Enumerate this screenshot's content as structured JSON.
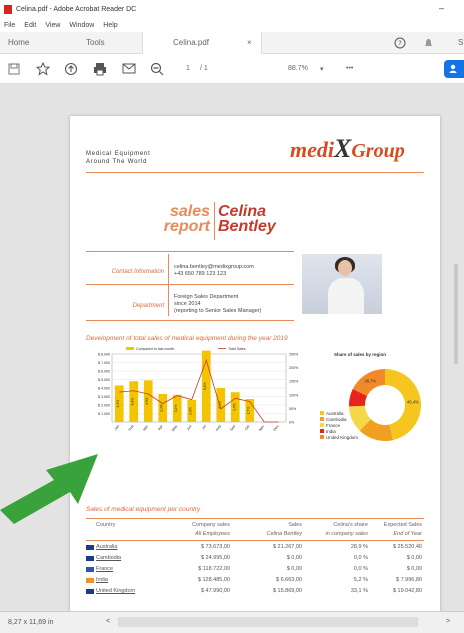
{
  "titlebar": {
    "title": "Celina.pdf - Adobe Acrobat Reader DC",
    "minimize": "–"
  },
  "menu": [
    "File",
    "Edit",
    "View",
    "Window",
    "Help"
  ],
  "tabs": {
    "home": "Home",
    "tools": "Tools",
    "doc": "Celina.pdf",
    "close": "×"
  },
  "toolbar": {
    "page_current": "1",
    "page_total": "/ 1",
    "zoom": "88.7%",
    "more": "•••",
    "zoom_caret": "▾"
  },
  "status": {
    "dimensions": "8,27 x 11,69 in",
    "left_arrow": "<",
    "right_arrow": ">"
  },
  "doc": {
    "tagline_1": "Medical Equipment",
    "tagline_2": "Around The World",
    "logo_a": "medi",
    "logo_b": "X",
    "logo_c": "Group",
    "sales_1": "sales",
    "sales_2": "report",
    "name_1": "Celina",
    "name_2": "Bentley",
    "contact_label": "Contact Information",
    "contact_email": "celina.bentley@medixgroup.com",
    "contact_phone": "+43 650 789 123 123",
    "dept_label": "Department",
    "dept_1": "Foreign Sales Department",
    "dept_2": "since 2014",
    "dept_3": "(reporting to Senior Sales Manager)",
    "chart_title": "Development of total sales of medical equipment during the year 2019",
    "pie_title": "Share of sales by region",
    "table_title": "Sales of medical equipment per country"
  },
  "chart_data": [
    {
      "type": "bar",
      "legend": [
        "Compared to last month",
        "Total Sales"
      ],
      "categories": [
        "Jan",
        "Feb",
        "Mar",
        "Apr",
        "May",
        "Jun",
        "Jul",
        "Aug",
        "Sep",
        "Oct",
        "Nov",
        "Dec"
      ],
      "y_left_ticks": [
        "$ 1.000",
        "$ 2.000",
        "$ 3.000",
        "$ 4.000",
        "$ 5.000",
        "$ 6.000",
        "$ 7.000",
        "$ 8.000"
      ],
      "y_right_ticks": [
        "0%",
        "50%",
        "100%",
        "150%",
        "200%",
        "250%"
      ],
      "series": [
        {
          "name": "Compared to last month",
          "values": [
            4.3,
            4.8,
            4.9,
            3.3,
            3.2,
            2.6,
            8.4,
            4.0,
            3.5,
            2.7,
            0.0,
            0.0
          ]
        },
        {
          "name": "Total Sales",
          "values": [
            110,
            115,
            103,
            68,
            97,
            82,
            227,
            48,
            87,
            75,
            0,
            0
          ]
        }
      ],
      "bar_labels": [
        "4,3%",
        "4,8%",
        "4,9%",
        "3,3%",
        "3,2%",
        "2,6%",
        "8,4%",
        "4,0%",
        "3,5%",
        "2,7%",
        "",
        ""
      ]
    },
    {
      "type": "pie",
      "title": "Share of sales by region",
      "categories": [
        "Australia",
        "Cambodia",
        "France",
        "India",
        "United Kingdom"
      ],
      "values": [
        46.4,
        16.0,
        12.0,
        8.0,
        17.6
      ],
      "value_labels": [
        "46,4%",
        "",
        "",
        "",
        "38,7%"
      ],
      "colors": [
        "#f7c520",
        "#f0a020",
        "#f5d84a",
        "#e8231a",
        "#f28a2a"
      ]
    }
  ],
  "table": {
    "headers": [
      "Country",
      "Company sales",
      "Sales",
      "Celina's share",
      "Expected Sales"
    ],
    "subheaders": [
      "",
      "All Employees",
      "Celina Bentley",
      "in company sales",
      "End of Year"
    ],
    "rows": [
      [
        "Australia",
        "$ 73.673,00",
        "$ 21.267,00",
        "28,9 %",
        "$ 25.520,40"
      ],
      [
        "Cambodia",
        "$ 24.995,00",
        "$ 0,00",
        "0,0 %",
        "$ 0,00"
      ],
      [
        "France",
        "$ 118.722,00",
        "$ 0,00",
        "0,0 %",
        "$ 0,00"
      ],
      [
        "India",
        "$ 128.485,00",
        "$ 6.663,00",
        "5,2 %",
        "$ 7.996,80"
      ],
      [
        "United Kingdom",
        "$ 47.990,00",
        "$ 15.869,00",
        "33,1 %",
        "$ 19.042,80"
      ]
    ],
    "flag_colors": [
      "#1b3b8a",
      "#1b3b8a",
      "#2c55b7",
      "#f09030",
      "#1b3b8a"
    ]
  },
  "colors": {
    "accent": "#e06840",
    "bar": "#f4c400",
    "line": "#c6392c",
    "acrobat_blue": "#1473e6",
    "arrow": "#3aa23a"
  }
}
